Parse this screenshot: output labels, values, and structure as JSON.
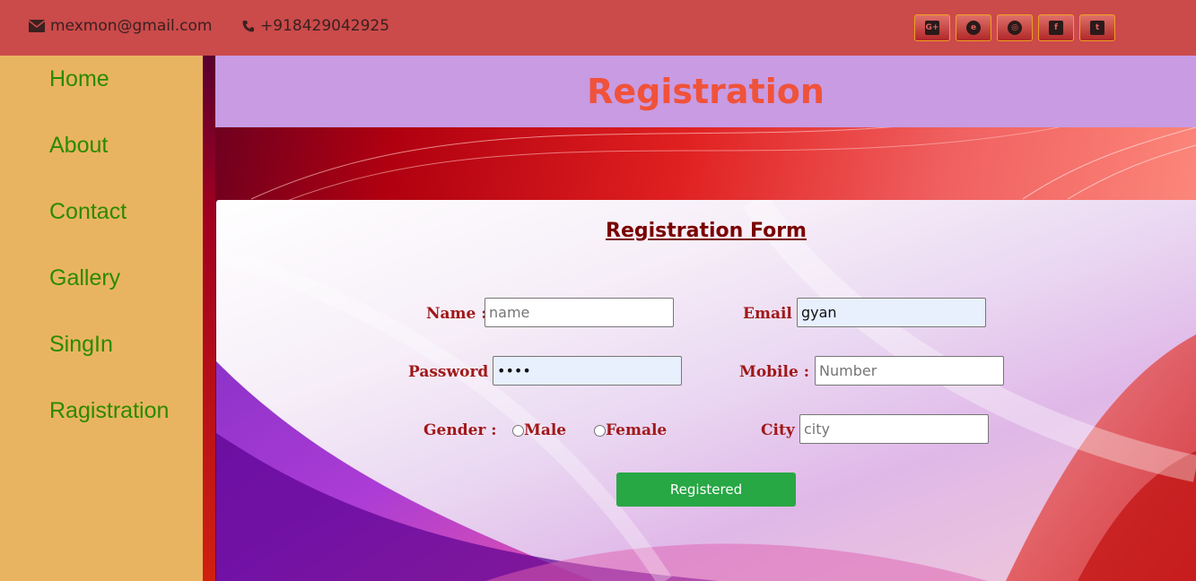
{
  "topbar": {
    "email": "mexmon@gmail.com",
    "phone": "+918429042925",
    "social": [
      {
        "icon": "google-plus-icon",
        "glyph": "G+"
      },
      {
        "icon": "internet-explorer-icon",
        "glyph": "e"
      },
      {
        "icon": "chrome-icon",
        "glyph": "◎"
      },
      {
        "icon": "facebook-icon",
        "glyph": "f"
      },
      {
        "icon": "twitter-icon",
        "glyph": "t"
      }
    ]
  },
  "sidebar": {
    "items": [
      {
        "label": "Home"
      },
      {
        "label": "About"
      },
      {
        "label": "Contact"
      },
      {
        "label": "Gallery"
      },
      {
        "label": "SingIn"
      },
      {
        "label": "Ragistration"
      }
    ]
  },
  "header": {
    "title": "Registration"
  },
  "form": {
    "title": "Registration Form",
    "name": {
      "label": "Name :",
      "placeholder": "name",
      "value": ""
    },
    "email": {
      "label": "Email :",
      "placeholder": "",
      "value": "gyan"
    },
    "password": {
      "label": "Password :",
      "placeholder": "",
      "value": "••••"
    },
    "mobile": {
      "label": "Mobile :",
      "placeholder": "Number",
      "value": ""
    },
    "gender": {
      "label": "Gender :",
      "options": [
        "Male",
        "Female"
      ]
    },
    "city": {
      "label": "City :",
      "placeholder": "city",
      "value": ""
    },
    "submit_label": "Registered"
  },
  "colors": {
    "topbar": "#cb4a4a",
    "sidebar": "#e9b461",
    "nav_text": "#2b8a00",
    "header_bg": "#c89be3",
    "header_text": "#f0523a",
    "form_label": "#a01818",
    "submit": "#28a745"
  }
}
